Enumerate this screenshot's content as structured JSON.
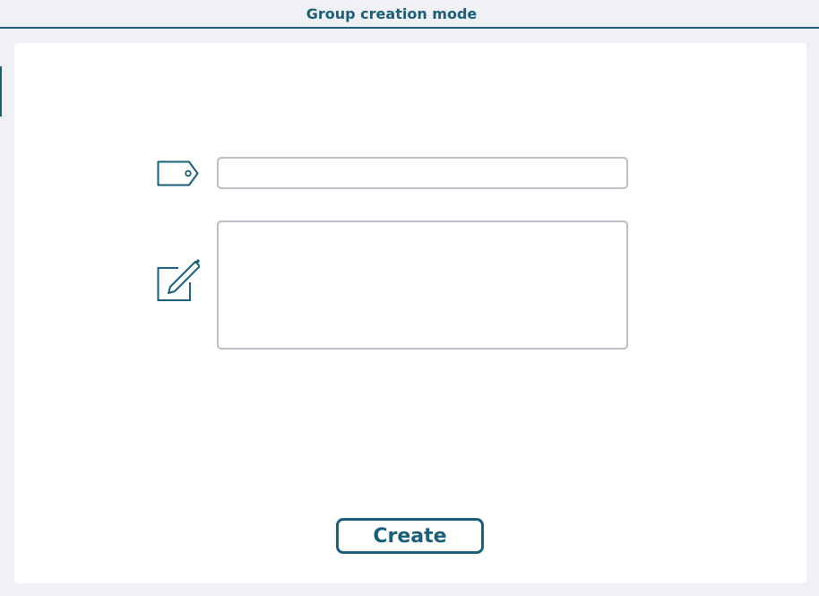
{
  "header": {
    "title": "Group creation mode"
  },
  "form": {
    "name_field": {
      "value": "",
      "icon": "tag-icon"
    },
    "description_field": {
      "value": "",
      "icon": "edit-icon"
    },
    "submit_label": "Create"
  },
  "colors": {
    "accent": "#1a5f77",
    "background": "#f0f1f4",
    "panel": "#ffffff",
    "field_border": "#bcbdc6"
  }
}
